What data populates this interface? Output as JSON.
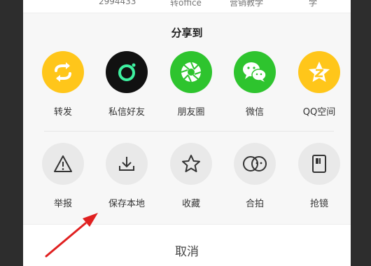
{
  "top_strip": {
    "items": [
      "2994433",
      "转office",
      "营销教学",
      "学"
    ]
  },
  "sheet": {
    "title": "分享到"
  },
  "share_row": [
    {
      "label": "转发",
      "icon": "retweet-icon",
      "color": "#ffc61a"
    },
    {
      "label": "私信好友",
      "icon": "private-message-icon",
      "color": "#111111"
    },
    {
      "label": "朋友圈",
      "icon": "moments-icon",
      "color": "#2ec42e"
    },
    {
      "label": "微信",
      "icon": "wechat-icon",
      "color": "#2ec42e"
    },
    {
      "label": "QQ空间",
      "icon": "qzone-icon",
      "color": "#ffc61a"
    }
  ],
  "action_row": [
    {
      "label": "举报",
      "icon": "report-warning-icon"
    },
    {
      "label": "保存本地",
      "icon": "download-icon"
    },
    {
      "label": "收藏",
      "icon": "star-icon"
    },
    {
      "label": "合拍",
      "icon": "duet-icon"
    },
    {
      "label": "抢镜",
      "icon": "stitch-icon"
    }
  ],
  "cancel_label": "取消",
  "annotation_arrow_color": "#e02020"
}
